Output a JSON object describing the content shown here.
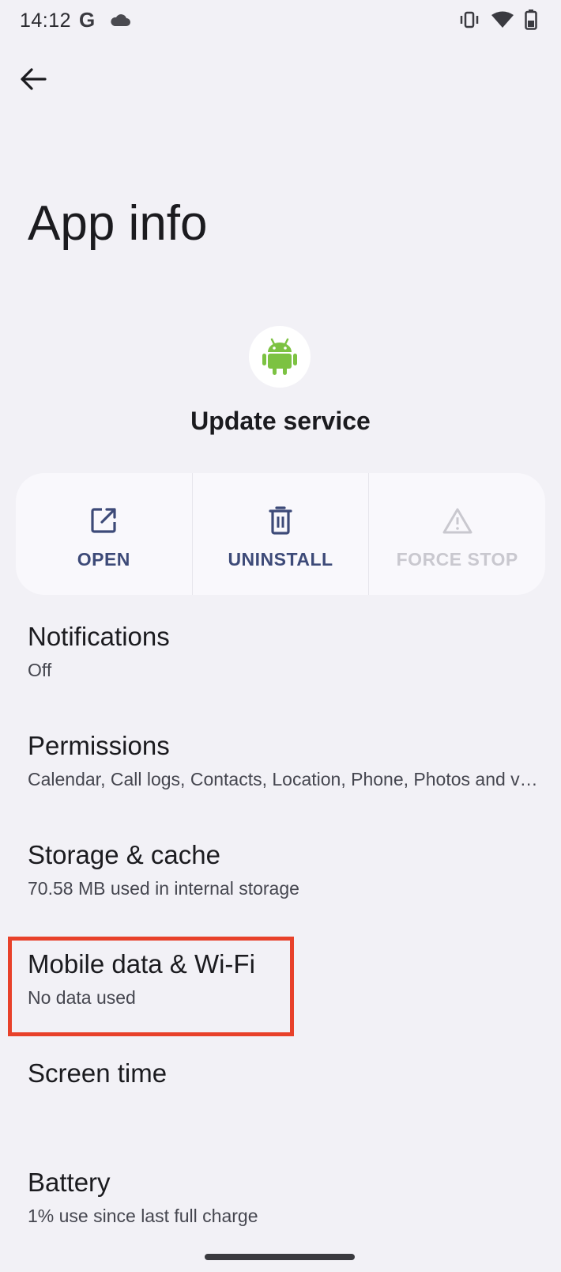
{
  "status_bar": {
    "time": "14:12",
    "g_label": "G",
    "icons": [
      "google-icon",
      "cloud-icon",
      "vibrate-icon",
      "wifi-icon",
      "battery-icon"
    ]
  },
  "header": {
    "back_icon": "arrow-left-icon",
    "title": "App info"
  },
  "app": {
    "name": "Update service",
    "icon": "android-icon",
    "icon_color": "#7cc242"
  },
  "actions": [
    {
      "label": "OPEN",
      "icon": "open-external-icon",
      "enabled": true
    },
    {
      "label": "UNINSTALL",
      "icon": "trash-icon",
      "enabled": true
    },
    {
      "label": "FORCE STOP",
      "icon": "warning-icon",
      "enabled": false
    }
  ],
  "settings": [
    {
      "title": "Notifications",
      "summary": "Off"
    },
    {
      "title": "Permissions",
      "summary": "Calendar, Call logs, Contacts, Location, Phone, Photos and videos"
    },
    {
      "title": "Storage & cache",
      "summary": "70.58 MB used in internal storage"
    },
    {
      "title": "Mobile data & Wi-Fi",
      "summary": "No data used"
    },
    {
      "title": "Screen time",
      "summary": ""
    },
    {
      "title": "Battery",
      "summary": "1% use since last full charge"
    }
  ],
  "colors": {
    "background": "#f2f1f6",
    "accent": "#3d4a78",
    "highlight": "#e8412a",
    "disabled": "#c9c8cf"
  }
}
